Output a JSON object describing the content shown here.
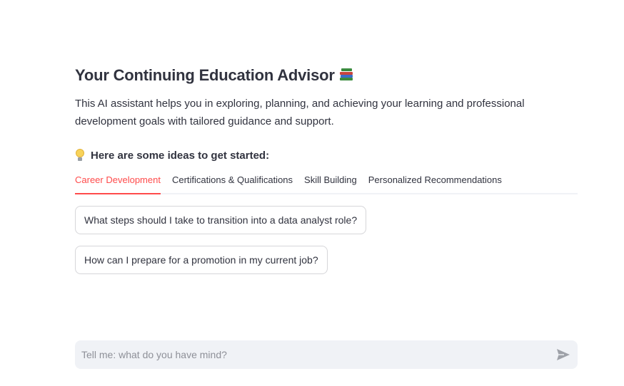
{
  "header": {
    "title": "Your Continuing Education Advisor",
    "title_icon": "books-icon"
  },
  "intro": {
    "description": "This AI assistant helps you in exploring, planning, and achieving your learning and professional development goals with tailored guidance and support."
  },
  "ideas": {
    "icon": "lightbulb-icon",
    "label": "Here are some ideas to get started:"
  },
  "tabs": [
    {
      "label": "Career Development",
      "active": true
    },
    {
      "label": "Certifications & Qualifications",
      "active": false
    },
    {
      "label": "Skill Building",
      "active": false
    },
    {
      "label": "Personalized Recommendations",
      "active": false
    }
  ],
  "suggestions": [
    {
      "label": "What steps should I take to transition into a data analyst role?"
    },
    {
      "label": "How can I prepare for a promotion in my current job?"
    }
  ],
  "chat": {
    "placeholder": "Tell me: what do you have mind?",
    "value": "",
    "send_icon": "send-icon"
  },
  "colors": {
    "accent": "#ff4b4b",
    "text": "#31333f",
    "input_bg": "#f0f2f6"
  }
}
